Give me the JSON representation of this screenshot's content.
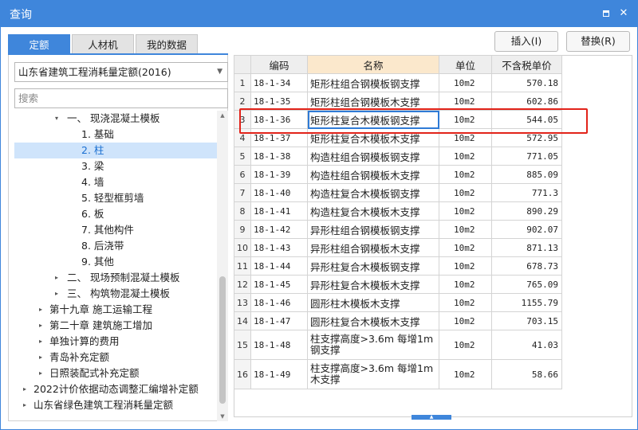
{
  "window": {
    "title": "查询",
    "close_glyph": "✕"
  },
  "tabs": [
    {
      "label": "定额",
      "active": true
    },
    {
      "label": "人材机",
      "active": false
    },
    {
      "label": "我的数据",
      "active": false
    }
  ],
  "toolbar": {
    "insert_label": "插入(I)",
    "replace_label": "替换(R)"
  },
  "sidebar": {
    "quota_selector": {
      "value": "山东省建筑工程消耗量定额(2016)"
    },
    "search": {
      "placeholder": "搜索"
    },
    "tree": [
      {
        "label": "一、 现浇混凝土模板",
        "expander": "▾",
        "selected": false
      },
      {
        "label": "1. 基础",
        "expander": "",
        "selected": false
      },
      {
        "label": "2. 柱",
        "expander": "",
        "selected": true
      },
      {
        "label": "3. 梁",
        "expander": "",
        "selected": false
      },
      {
        "label": "4. 墙",
        "expander": "",
        "selected": false
      },
      {
        "label": "5. 轻型框剪墙",
        "expander": "",
        "selected": false
      },
      {
        "label": "6. 板",
        "expander": "",
        "selected": false
      },
      {
        "label": "7. 其他构件",
        "expander": "",
        "selected": false
      },
      {
        "label": "8. 后浇带",
        "expander": "",
        "selected": false
      },
      {
        "label": "9. 其他",
        "expander": "",
        "selected": false
      },
      {
        "label": "二、 现场预制混凝土模板",
        "expander": "▸",
        "selected": false
      },
      {
        "label": "三、 构筑物混凝土模板",
        "expander": "▸",
        "selected": false
      },
      {
        "label": "第十九章 施工运输工程",
        "expander": "▸",
        "selected": false
      },
      {
        "label": "第二十章 建筑施工增加",
        "expander": "▸",
        "selected": false
      },
      {
        "label": "单独计算的费用",
        "expander": "▸",
        "selected": false
      },
      {
        "label": "青岛补充定额",
        "expander": "▸",
        "selected": false
      },
      {
        "label": "日照装配式补充定额",
        "expander": "▸",
        "selected": false
      },
      {
        "label": "2022计价依据动态调整汇编增补定额",
        "expander": "▸",
        "selected": false
      },
      {
        "label": "山东省绿色建筑工程消耗量定额",
        "expander": "▸",
        "selected": false
      }
    ]
  },
  "table": {
    "columns": [
      "编码",
      "名称",
      "单位",
      "不含税单价"
    ],
    "rows": [
      {
        "rn": "1",
        "code": "18-1-34",
        "name": "矩形柱组合钢模板钢支撑",
        "unit": "10m2",
        "price": "570.18"
      },
      {
        "rn": "2",
        "code": "18-1-35",
        "name": "矩形柱组合钢模板木支撑",
        "unit": "10m2",
        "price": "602.86"
      },
      {
        "rn": "3",
        "code": "18-1-36",
        "name": "矩形柱复合木模板钢支撑",
        "unit": "10m2",
        "price": "544.05"
      },
      {
        "rn": "4",
        "code": "18-1-37",
        "name": "矩形柱复合木模板木支撑",
        "unit": "10m2",
        "price": "572.95"
      },
      {
        "rn": "5",
        "code": "18-1-38",
        "name": "构造柱组合钢模板钢支撑",
        "unit": "10m2",
        "price": "771.05"
      },
      {
        "rn": "6",
        "code": "18-1-39",
        "name": "构造柱组合钢模板木支撑",
        "unit": "10m2",
        "price": "885.09"
      },
      {
        "rn": "7",
        "code": "18-1-40",
        "name": "构造柱复合木模板钢支撑",
        "unit": "10m2",
        "price": "771.3"
      },
      {
        "rn": "8",
        "code": "18-1-41",
        "name": "构造柱复合木模板木支撑",
        "unit": "10m2",
        "price": "890.29"
      },
      {
        "rn": "9",
        "code": "18-1-42",
        "name": "异形柱组合钢模板钢支撑",
        "unit": "10m2",
        "price": "902.07"
      },
      {
        "rn": "10",
        "code": "18-1-43",
        "name": "异形柱组合钢模板木支撑",
        "unit": "10m2",
        "price": "871.13"
      },
      {
        "rn": "11",
        "code": "18-1-44",
        "name": "异形柱复合木模板钢支撑",
        "unit": "10m2",
        "price": "678.73"
      },
      {
        "rn": "12",
        "code": "18-1-45",
        "name": "异形柱复合木模板木支撑",
        "unit": "10m2",
        "price": "765.09"
      },
      {
        "rn": "13",
        "code": "18-1-46",
        "name": "圆形柱木模板木支撑",
        "unit": "10m2",
        "price": "1155.79"
      },
      {
        "rn": "14",
        "code": "18-1-47",
        "name": "圆形柱复合木模板木支撑",
        "unit": "10m2",
        "price": "703.15"
      },
      {
        "rn": "15",
        "code": "18-1-48",
        "name": "柱支撑高度>3.6m 每增1m钢支撑",
        "unit": "10m2",
        "price": "41.03"
      },
      {
        "rn": "16",
        "code": "18-1-49",
        "name": "柱支撑高度>3.6m 每增1m木支撑",
        "unit": "10m2",
        "price": "58.66"
      }
    ]
  },
  "colors": {
    "accent": "#3f86db",
    "highlight_border": "#e2231a",
    "selected_row": "#cfe4fb",
    "name_header": "#fbe8cc"
  }
}
